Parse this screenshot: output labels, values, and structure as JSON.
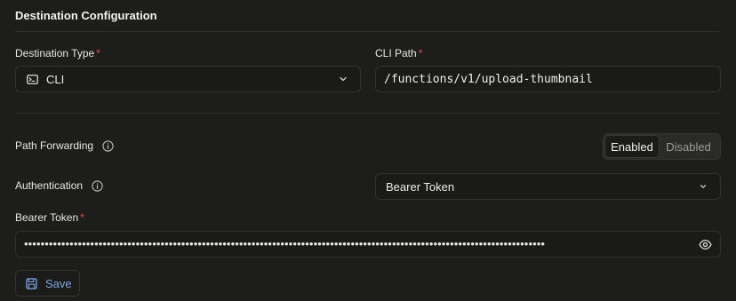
{
  "section": {
    "title": "Destination Configuration"
  },
  "destination_type": {
    "label": "Destination Type",
    "required_mark": "*",
    "value": "CLI",
    "icon": "terminal-icon"
  },
  "cli_path": {
    "label": "CLI Path",
    "required_mark": "*",
    "value": "/functions/v1/upload-thumbnail"
  },
  "path_forwarding": {
    "label": "Path Forwarding",
    "options": [
      "Enabled",
      "Disabled"
    ],
    "selected": "Enabled"
  },
  "authentication": {
    "label": "Authentication",
    "value": "Bearer Token"
  },
  "bearer_token": {
    "label": "Bearer Token",
    "required_mark": "*",
    "masked_value": "••••••••••••••••••••••••••••••••••••••••••••••••••••••••••••••••••••••••••••••••••••••••••••••••••••••••••••••••••••••••••••••"
  },
  "actions": {
    "save_label": "Save"
  },
  "colors": {
    "background": "#1d1d1b",
    "required": "#e5484d",
    "save_accent": "#7ea6e8"
  }
}
